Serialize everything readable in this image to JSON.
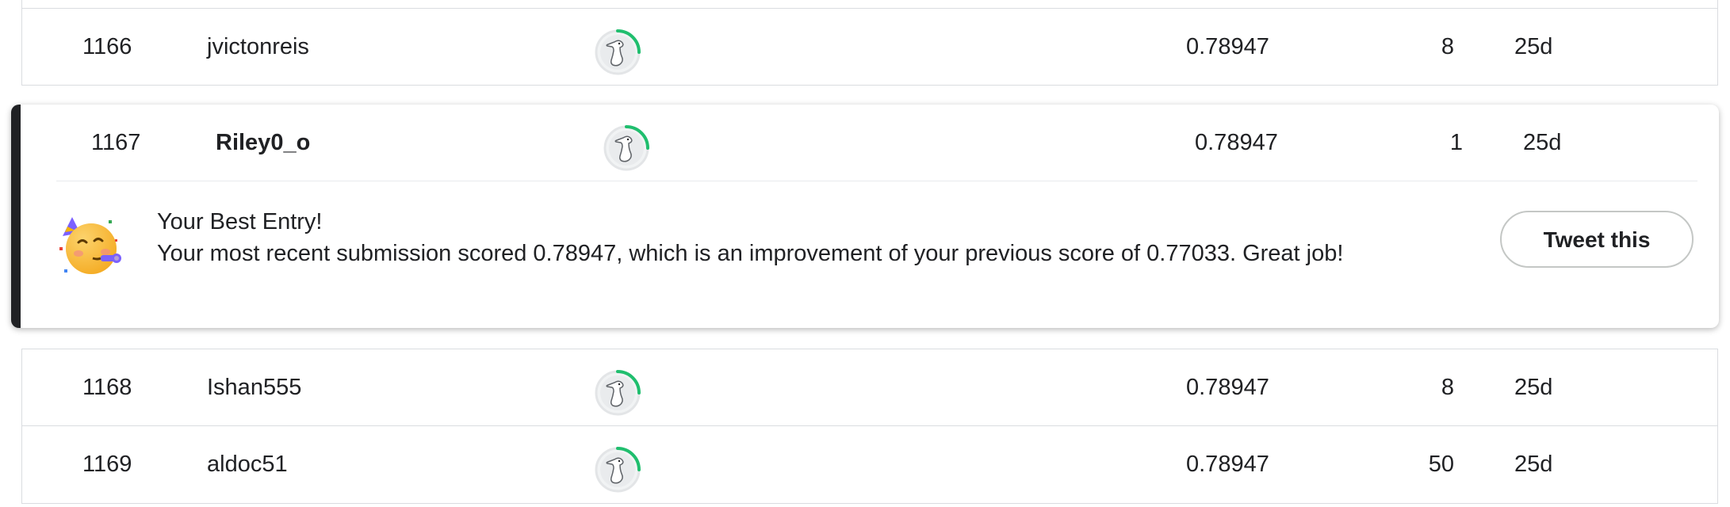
{
  "leaderboard": {
    "rows": [
      {
        "rank": "1166",
        "team": "jvictonreis",
        "score": "0.78947",
        "entries": "8",
        "last": "25d"
      },
      {
        "rank": "1167",
        "team": "Riley0_o",
        "score": "0.78947",
        "entries": "1",
        "last": "25d"
      },
      {
        "rank": "1168",
        "team": "Ishan555",
        "score": "0.78947",
        "entries": "8",
        "last": "25d"
      },
      {
        "rank": "1169",
        "team": "aldoc51",
        "score": "0.78947",
        "entries": "50",
        "last": "25d"
      }
    ],
    "highlight_index": 1
  },
  "best_entry": {
    "emoji": "partying-face-emoji",
    "title": "Your Best Entry!",
    "message": "Your most recent submission scored 0.78947, which is an improvement of your previous score of 0.77033. Great job!",
    "tweet_label": "Tweet this"
  },
  "avatar": {
    "icon": "goose-avatar-icon",
    "ring_color": "#20be6e"
  }
}
